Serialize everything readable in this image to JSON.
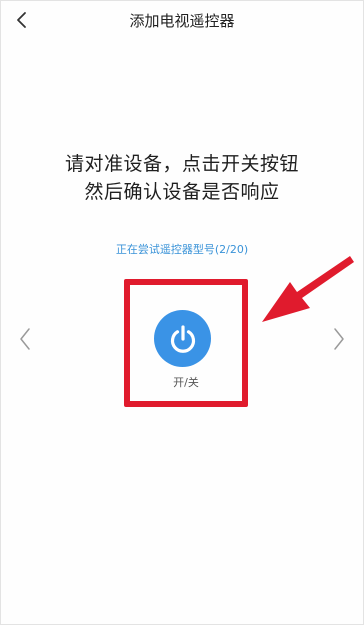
{
  "header": {
    "title": "添加电视遥控器",
    "back_icon": "chevron-left-icon"
  },
  "instructions": {
    "line1": "请对准设备，点击开关按钮",
    "line2": "然后确认设备是否响应"
  },
  "status": {
    "text": "正在尝试遥控器型号(2/20)"
  },
  "remote": {
    "power_label": "开/关",
    "power_icon": "power-icon",
    "prev_icon": "chevron-left-icon",
    "next_icon": "chevron-right-icon"
  },
  "colors": {
    "accent": "#3a93e6",
    "highlight": "#e01b2d",
    "status_text": "#3a93d8"
  }
}
